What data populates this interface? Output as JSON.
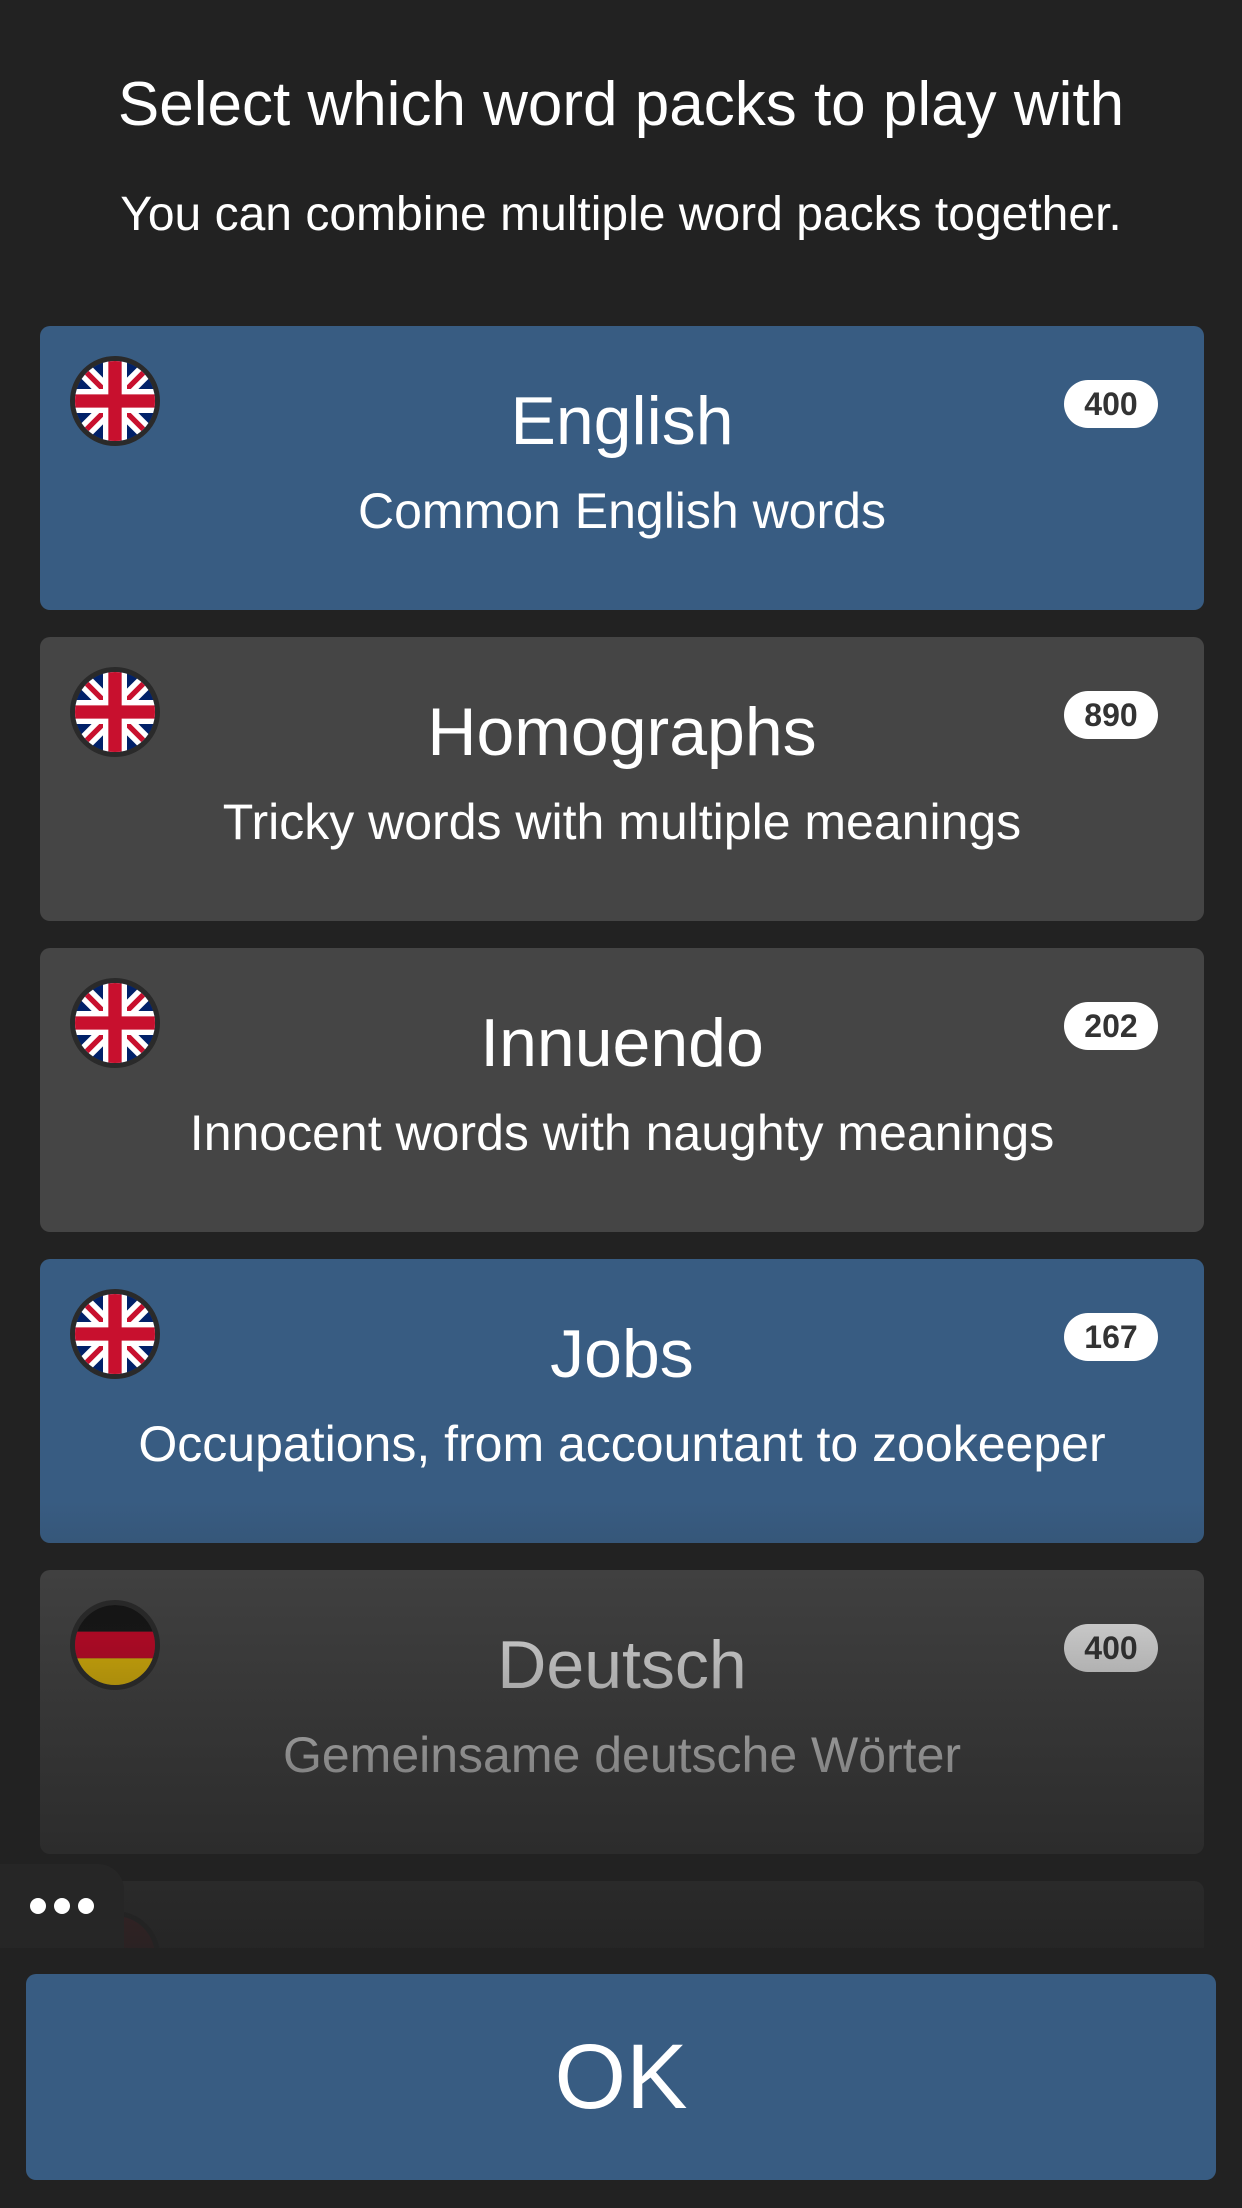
{
  "header": {
    "title": "Select which word packs to play with",
    "subtitle": "You can combine multiple word packs together."
  },
  "packs": [
    {
      "name": "English",
      "description": "Common English words",
      "count": "400",
      "flag": "uk-flag-icon",
      "selected": true
    },
    {
      "name": "Homographs",
      "description": "Tricky words with multiple meanings",
      "count": "890",
      "flag": "uk-flag-icon",
      "selected": false
    },
    {
      "name": "Innuendo",
      "description": "Innocent words with naughty meanings",
      "count": "202",
      "flag": "uk-flag-icon",
      "selected": false
    },
    {
      "name": "Jobs",
      "description": "Occupations, from accountant to zookeeper",
      "count": "167",
      "flag": "uk-flag-icon",
      "selected": true
    },
    {
      "name": "Deutsch",
      "description": "Gemeinsame deutsche Wörter",
      "count": "400",
      "flag": "germany-flag-icon",
      "selected": false
    }
  ],
  "more_button": {
    "icon": "more-horizontal-icon"
  },
  "footer": {
    "ok_label": "OK"
  },
  "colors": {
    "background": "#222222",
    "selected_pack": "#385c82",
    "unselected_pack": "#454545",
    "button": "#385c82"
  }
}
